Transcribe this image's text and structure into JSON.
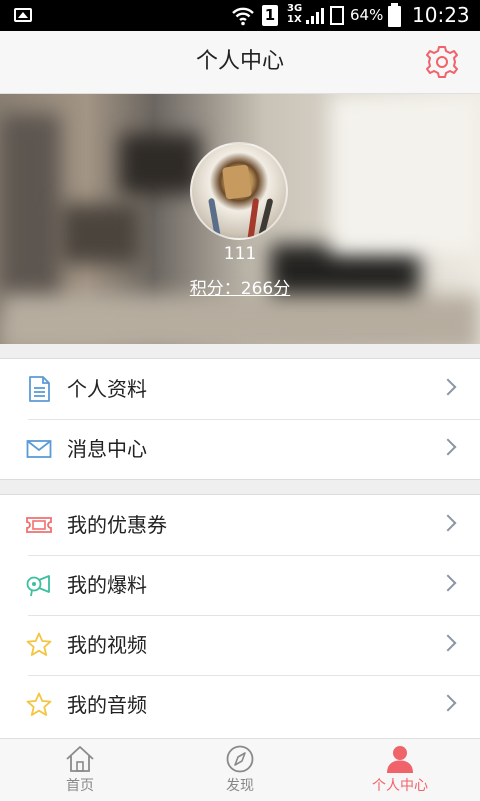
{
  "status_bar": {
    "sim_slot": "1",
    "network_top": "3G",
    "network_bottom": "1X",
    "battery_percent": "64%",
    "time": "10:23"
  },
  "header": {
    "title": "个人中心",
    "settings_icon": "gear-icon"
  },
  "profile": {
    "username": "111",
    "points_label": "积分：266分"
  },
  "menu_group_1": [
    {
      "label": "个人资料",
      "icon": "document-icon"
    },
    {
      "label": "消息中心",
      "icon": "envelope-icon"
    }
  ],
  "menu_group_2": [
    {
      "label": "我的优惠券",
      "icon": "ticket-icon"
    },
    {
      "label": "我的爆料",
      "icon": "megaphone-icon"
    },
    {
      "label": "我的视频",
      "icon": "star-icon"
    },
    {
      "label": "我的音频",
      "icon": "star-icon"
    }
  ],
  "tabs": [
    {
      "label": "首页",
      "icon": "home-icon",
      "active": false
    },
    {
      "label": "发现",
      "icon": "compass-icon",
      "active": false
    },
    {
      "label": "个人中心",
      "icon": "person-icon",
      "active": true
    }
  ],
  "colors": {
    "accent": "#f0636a",
    "blue_icon": "#5b9bd5",
    "green_icon": "#3bbf9e",
    "yellow_icon": "#f3c542",
    "red_icon": "#f07070"
  }
}
